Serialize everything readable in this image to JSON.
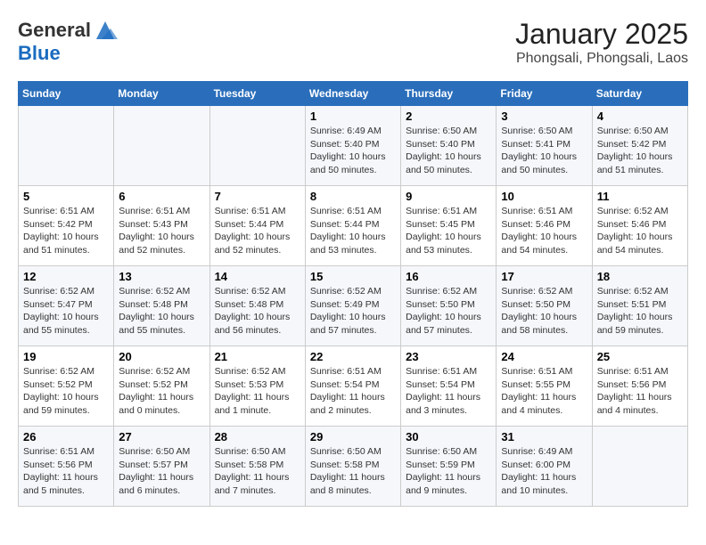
{
  "header": {
    "logo_line1": "General",
    "logo_line2": "Blue",
    "month": "January 2025",
    "location": "Phongsali, Phongsali, Laos"
  },
  "days_of_week": [
    "Sunday",
    "Monday",
    "Tuesday",
    "Wednesday",
    "Thursday",
    "Friday",
    "Saturday"
  ],
  "weeks": [
    [
      {
        "day": "",
        "info": ""
      },
      {
        "day": "",
        "info": ""
      },
      {
        "day": "",
        "info": ""
      },
      {
        "day": "1",
        "info": "Sunrise: 6:49 AM\nSunset: 5:40 PM\nDaylight: 10 hours\nand 50 minutes."
      },
      {
        "day": "2",
        "info": "Sunrise: 6:50 AM\nSunset: 5:40 PM\nDaylight: 10 hours\nand 50 minutes."
      },
      {
        "day": "3",
        "info": "Sunrise: 6:50 AM\nSunset: 5:41 PM\nDaylight: 10 hours\nand 50 minutes."
      },
      {
        "day": "4",
        "info": "Sunrise: 6:50 AM\nSunset: 5:42 PM\nDaylight: 10 hours\nand 51 minutes."
      }
    ],
    [
      {
        "day": "5",
        "info": "Sunrise: 6:51 AM\nSunset: 5:42 PM\nDaylight: 10 hours\nand 51 minutes."
      },
      {
        "day": "6",
        "info": "Sunrise: 6:51 AM\nSunset: 5:43 PM\nDaylight: 10 hours\nand 52 minutes."
      },
      {
        "day": "7",
        "info": "Sunrise: 6:51 AM\nSunset: 5:44 PM\nDaylight: 10 hours\nand 52 minutes."
      },
      {
        "day": "8",
        "info": "Sunrise: 6:51 AM\nSunset: 5:44 PM\nDaylight: 10 hours\nand 53 minutes."
      },
      {
        "day": "9",
        "info": "Sunrise: 6:51 AM\nSunset: 5:45 PM\nDaylight: 10 hours\nand 53 minutes."
      },
      {
        "day": "10",
        "info": "Sunrise: 6:51 AM\nSunset: 5:46 PM\nDaylight: 10 hours\nand 54 minutes."
      },
      {
        "day": "11",
        "info": "Sunrise: 6:52 AM\nSunset: 5:46 PM\nDaylight: 10 hours\nand 54 minutes."
      }
    ],
    [
      {
        "day": "12",
        "info": "Sunrise: 6:52 AM\nSunset: 5:47 PM\nDaylight: 10 hours\nand 55 minutes."
      },
      {
        "day": "13",
        "info": "Sunrise: 6:52 AM\nSunset: 5:48 PM\nDaylight: 10 hours\nand 55 minutes."
      },
      {
        "day": "14",
        "info": "Sunrise: 6:52 AM\nSunset: 5:48 PM\nDaylight: 10 hours\nand 56 minutes."
      },
      {
        "day": "15",
        "info": "Sunrise: 6:52 AM\nSunset: 5:49 PM\nDaylight: 10 hours\nand 57 minutes."
      },
      {
        "day": "16",
        "info": "Sunrise: 6:52 AM\nSunset: 5:50 PM\nDaylight: 10 hours\nand 57 minutes."
      },
      {
        "day": "17",
        "info": "Sunrise: 6:52 AM\nSunset: 5:50 PM\nDaylight: 10 hours\nand 58 minutes."
      },
      {
        "day": "18",
        "info": "Sunrise: 6:52 AM\nSunset: 5:51 PM\nDaylight: 10 hours\nand 59 minutes."
      }
    ],
    [
      {
        "day": "19",
        "info": "Sunrise: 6:52 AM\nSunset: 5:52 PM\nDaylight: 10 hours\nand 59 minutes."
      },
      {
        "day": "20",
        "info": "Sunrise: 6:52 AM\nSunset: 5:52 PM\nDaylight: 11 hours\nand 0 minutes."
      },
      {
        "day": "21",
        "info": "Sunrise: 6:52 AM\nSunset: 5:53 PM\nDaylight: 11 hours\nand 1 minute."
      },
      {
        "day": "22",
        "info": "Sunrise: 6:51 AM\nSunset: 5:54 PM\nDaylight: 11 hours\nand 2 minutes."
      },
      {
        "day": "23",
        "info": "Sunrise: 6:51 AM\nSunset: 5:54 PM\nDaylight: 11 hours\nand 3 minutes."
      },
      {
        "day": "24",
        "info": "Sunrise: 6:51 AM\nSunset: 5:55 PM\nDaylight: 11 hours\nand 4 minutes."
      },
      {
        "day": "25",
        "info": "Sunrise: 6:51 AM\nSunset: 5:56 PM\nDaylight: 11 hours\nand 4 minutes."
      }
    ],
    [
      {
        "day": "26",
        "info": "Sunrise: 6:51 AM\nSunset: 5:56 PM\nDaylight: 11 hours\nand 5 minutes."
      },
      {
        "day": "27",
        "info": "Sunrise: 6:50 AM\nSunset: 5:57 PM\nDaylight: 11 hours\nand 6 minutes."
      },
      {
        "day": "28",
        "info": "Sunrise: 6:50 AM\nSunset: 5:58 PM\nDaylight: 11 hours\nand 7 minutes."
      },
      {
        "day": "29",
        "info": "Sunrise: 6:50 AM\nSunset: 5:58 PM\nDaylight: 11 hours\nand 8 minutes."
      },
      {
        "day": "30",
        "info": "Sunrise: 6:50 AM\nSunset: 5:59 PM\nDaylight: 11 hours\nand 9 minutes."
      },
      {
        "day": "31",
        "info": "Sunrise: 6:49 AM\nSunset: 6:00 PM\nDaylight: 11 hours\nand 10 minutes."
      },
      {
        "day": "",
        "info": ""
      }
    ]
  ]
}
